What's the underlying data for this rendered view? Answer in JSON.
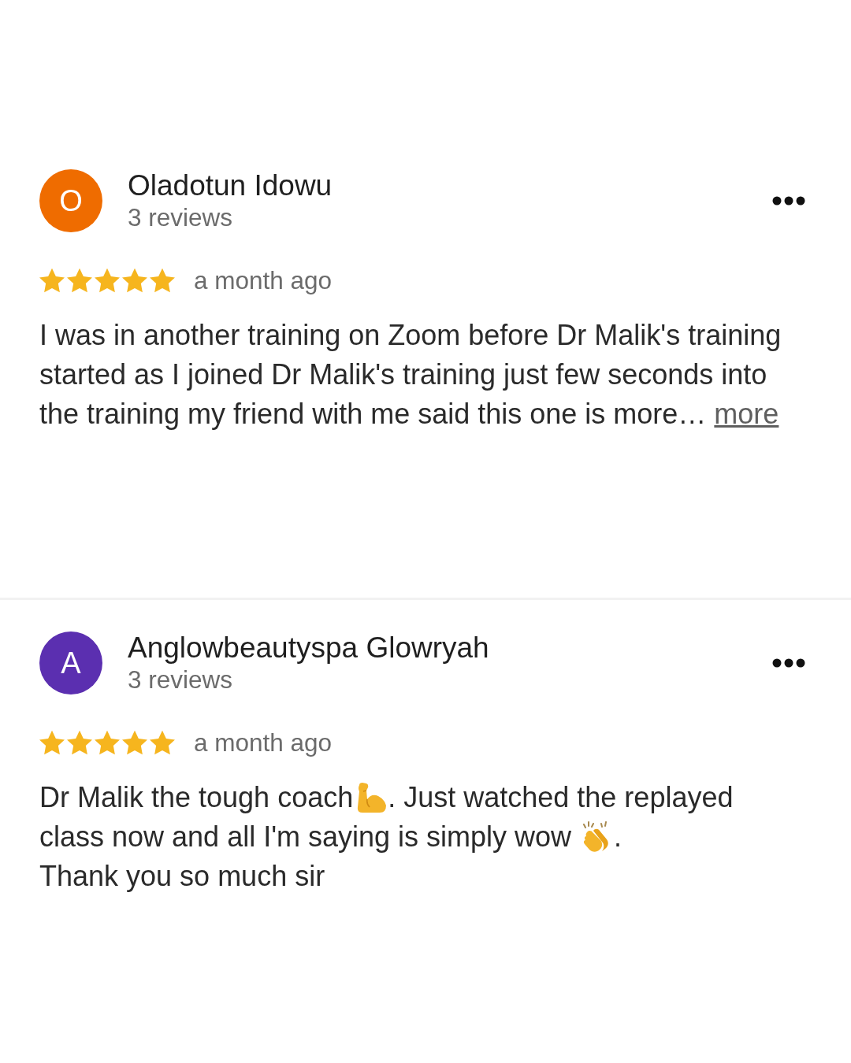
{
  "reviews": [
    {
      "avatar": {
        "letter": "O",
        "color": "#ef6c00"
      },
      "name": "Oladotun Idowu",
      "meta": "3 reviews",
      "stars": 5,
      "time": "a month ago",
      "body": [
        {
          "kind": "text",
          "text": "I was in another training on Zoom before Dr Malik's training started as I joined Dr Malik's training just few seconds into the training my friend with me said this one is more… "
        },
        {
          "kind": "link",
          "text": "more"
        }
      ]
    },
    {
      "avatar": {
        "letter": "A",
        "color": "#5b2fb0"
      },
      "name": "Anglowbeautyspa Glowryah",
      "meta": "3 reviews",
      "stars": 5,
      "time": "a month ago",
      "body": [
        {
          "kind": "text",
          "text": "Dr Malik the tough coach"
        },
        {
          "kind": "biceps"
        },
        {
          "kind": "text",
          "text": ". Just watched the replayed class now and all I'm saying is simply wow "
        },
        {
          "kind": "clap"
        },
        {
          "kind": "text",
          "text": ".\nThank you so much sir"
        }
      ]
    }
  ]
}
